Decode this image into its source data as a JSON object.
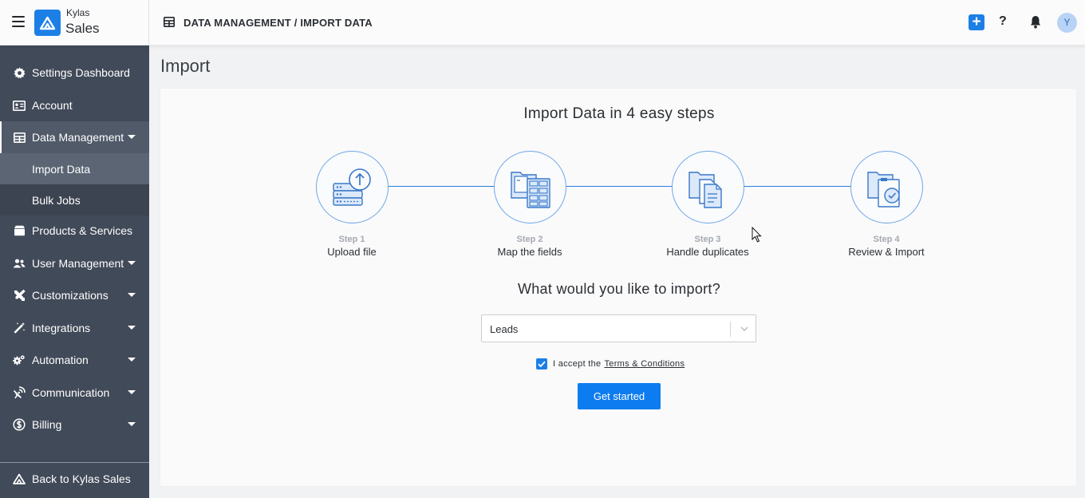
{
  "app": {
    "brand_top": "Kylas",
    "brand_bottom": "Sales",
    "breadcrumb": "DATA MANAGEMENT / IMPORT DATA",
    "avatar_initial": "Y",
    "add_label": "+",
    "help_label": "?"
  },
  "sidebar": {
    "items": [
      {
        "label": "Settings Dashboard",
        "icon": "gear-icon"
      },
      {
        "label": "Account",
        "icon": "id-card-icon"
      },
      {
        "label": "Data Management",
        "icon": "table-icon"
      },
      {
        "label": "Products & Services",
        "icon": "box-icon"
      },
      {
        "label": "User Management",
        "icon": "users-icon"
      },
      {
        "label": "Customizations",
        "icon": "tools-icon"
      },
      {
        "label": "Integrations",
        "icon": "magic-wand-icon"
      },
      {
        "label": "Automation",
        "icon": "cogs-icon"
      },
      {
        "label": "Communication",
        "icon": "satellite-dish-icon"
      },
      {
        "label": "Billing",
        "icon": "dollar-circle-icon"
      }
    ],
    "sub_items": [
      {
        "label": "Import Data"
      },
      {
        "label": "Bulk Jobs"
      }
    ],
    "back_label": "Back to Kylas Sales"
  },
  "main": {
    "page_title": "Import",
    "heading": "Import Data in 4 easy steps",
    "steps": [
      {
        "num": "Step 1",
        "name": "Upload file"
      },
      {
        "num": "Step 2",
        "name": "Map the fields"
      },
      {
        "num": "Step 3",
        "name": "Handle duplicates"
      },
      {
        "num": "Step 4",
        "name": "Review & Import"
      }
    ],
    "question": "What would you like to import?",
    "select_value": "Leads",
    "accept_text": "I accept the",
    "terms_link": "Terms & Conditions",
    "start_button": "Get started"
  },
  "colors": {
    "accent": "#1c7fe6",
    "sidebar_bg": "#414a58",
    "step_line": "#2f7ed8"
  }
}
